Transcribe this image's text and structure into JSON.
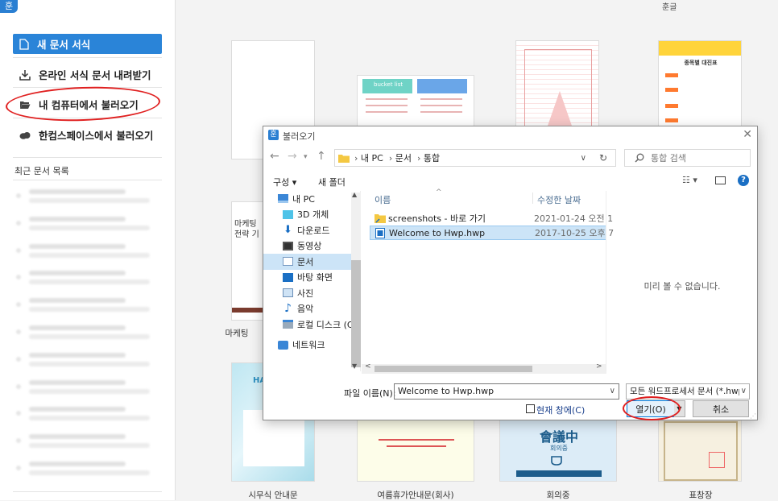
{
  "app": {
    "logo": "훈",
    "header_title": "훈글"
  },
  "left_panel": {
    "new_doc": "새 문서 서식",
    "online_templates": "온라인 서식 문서 내려받기",
    "open_from_pc": "내 컴퓨터에서 불러오기",
    "open_from_hancom_space": "한컴스페이스에서 불러오기",
    "recent_title": "최근 문서 목록"
  },
  "templates": {
    "t1": "시무식 안내문",
    "t2": "여름휴가안내문(회사)",
    "t3": "회의중",
    "t4": "표창장",
    "t5": "마케팅",
    "card_marketing_title": "마케팅",
    "card_marketing_sub": "전략 기",
    "card_bucket": "bucket list",
    "card_org": "종목별 대진표",
    "card_meeting": "會議中",
    "card_meeting_sub": "회의중",
    "card_happy": "HAP"
  },
  "dialog": {
    "title": "불러오기",
    "breadcrumb": [
      "내 PC",
      "문서",
      "통합"
    ],
    "search_placeholder": "통합 검색",
    "toolbar_organize": "구성 ▾",
    "toolbar_new_folder": "새 폴더",
    "tree": [
      "내 PC",
      "3D 개체",
      "다운로드",
      "동영상",
      "문서",
      "바탕 화면",
      "사진",
      "음악",
      "로컬 디스크 (C:)",
      "네트워크"
    ],
    "col_name": "이름",
    "col_modified": "수정한 날짜",
    "files": [
      {
        "name": "screenshots - 바로 가기",
        "date": "2021-01-24 오전 1"
      },
      {
        "name": "Welcome to Hwp.hwp",
        "date": "2017-10-25 오후 7"
      }
    ],
    "preview_text": "미리 볼 수 없습니다.",
    "filename_label": "파일 이름(N):",
    "filename_value": "Welcome to Hwp.hwp",
    "filetype": "모든 워드프로세서 문서 (*.hwp",
    "current_window": "현재 창에(C)",
    "open_button": "열기(O)",
    "cancel_button": "취소"
  }
}
